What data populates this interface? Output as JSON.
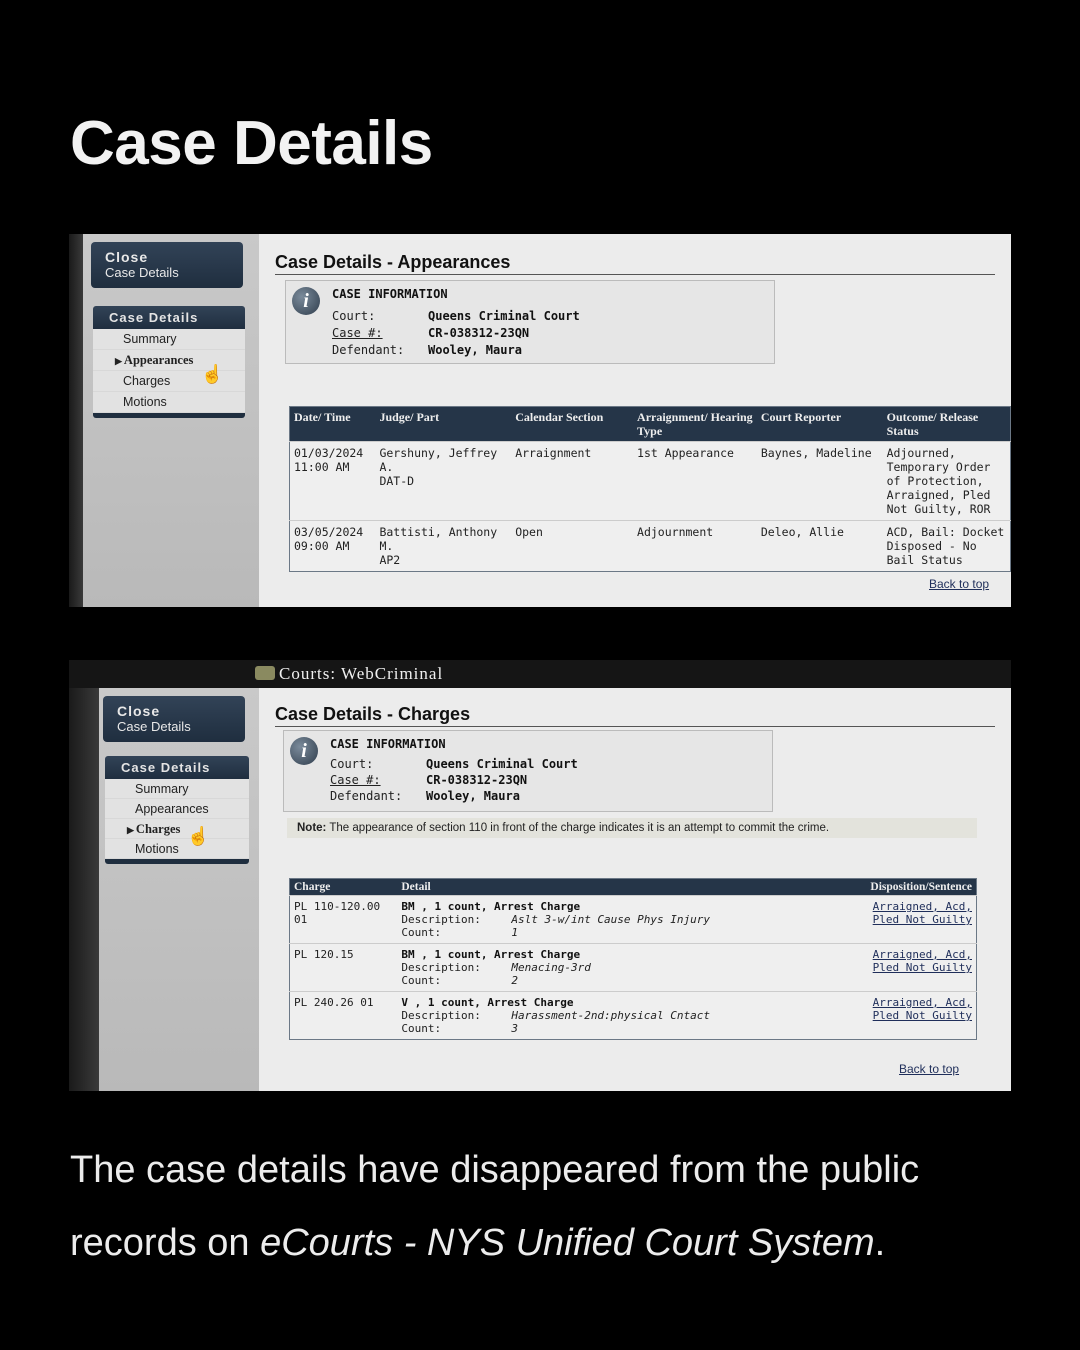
{
  "page": {
    "title": "Case Details",
    "caption_prefix": "The case details have disappeared from the public records on ",
    "caption_source": "eCourts - NYS Unified Court System",
    "caption_suffix": "."
  },
  "shot2_header": {
    "brand": "Courts: WebCriminal"
  },
  "sidebar": {
    "close_title": "Close",
    "close_sub": "Case Details",
    "menu_head": "Case Details",
    "items": [
      "Summary",
      "Appearances",
      "Charges",
      "Motions"
    ]
  },
  "case_info": {
    "heading": "CASE INFORMATION",
    "court_label": "Court:",
    "court": "Queens Criminal Court",
    "case_label": "Case #:",
    "case_no": "CR-038312-23QN",
    "defendant_label": "Defendant:",
    "defendant": "Wooley, Maura"
  },
  "appearances": {
    "section_title": "Case Details - Appearances",
    "headers": [
      "Date/ Time",
      "Judge/ Part",
      "Calendar Section",
      "Arraignment/ Hearing Type",
      "Court Reporter",
      "Outcome/ Release Status"
    ],
    "rows": [
      {
        "date": "01/03/2024",
        "time": "11:00 AM",
        "judge": "Gershuny, Jeffrey A.",
        "part": "DAT-D",
        "calendar": "Arraignment",
        "hearing": "1st Appearance",
        "reporter": "Baynes, Madeline",
        "outcome": "Adjourned, Temporary Order of Protection, Arraigned, Pled Not Guilty, ROR"
      },
      {
        "date": "03/05/2024",
        "time": "09:00 AM",
        "judge": "Battisti, Anthony M.",
        "part": "AP2",
        "calendar": "Open",
        "hearing": "Adjournment",
        "reporter": "Deleo, Allie",
        "outcome": "ACD, Bail: Docket Disposed - No Bail Status"
      }
    ],
    "back_to_top": "Back to top"
  },
  "charges": {
    "section_title": "Case Details - Charges",
    "note_label": "Note:",
    "note_text": "The appearance of section 110 in front of the charge indicates it is an attempt to commit the crime.",
    "headers": {
      "charge": "Charge",
      "detail": "Detail",
      "disposition": "Disposition/Sentence"
    },
    "description_label": "Description:",
    "count_label": "Count:",
    "rows": [
      {
        "charge": "PL 110-120.00 01",
        "title": "BM , 1 count, Arrest Charge",
        "description": "Aslt 3-w/int Cause Phys Injury",
        "count": "1",
        "disp1": "Arraigned, Acd,",
        "disp2": "Pled Not Guilty"
      },
      {
        "charge": "PL 120.15",
        "title": "BM , 1 count, Arrest Charge",
        "description": "Menacing-3rd",
        "count": "2",
        "disp1": "Arraigned, Acd,",
        "disp2": "Pled Not Guilty"
      },
      {
        "charge": "PL 240.26 01",
        "title": "V , 1 count, Arrest Charge",
        "description": "Harassment-2nd:physical Cntact",
        "count": "3",
        "disp1": "Arraigned, Acd,",
        "disp2": "Pled Not Guilty"
      }
    ],
    "back_to_top": "Back to top"
  },
  "icons": {
    "info": "info-icon",
    "cursor": "hand-cursor-icon",
    "arrow": "triangle-right-icon"
  }
}
